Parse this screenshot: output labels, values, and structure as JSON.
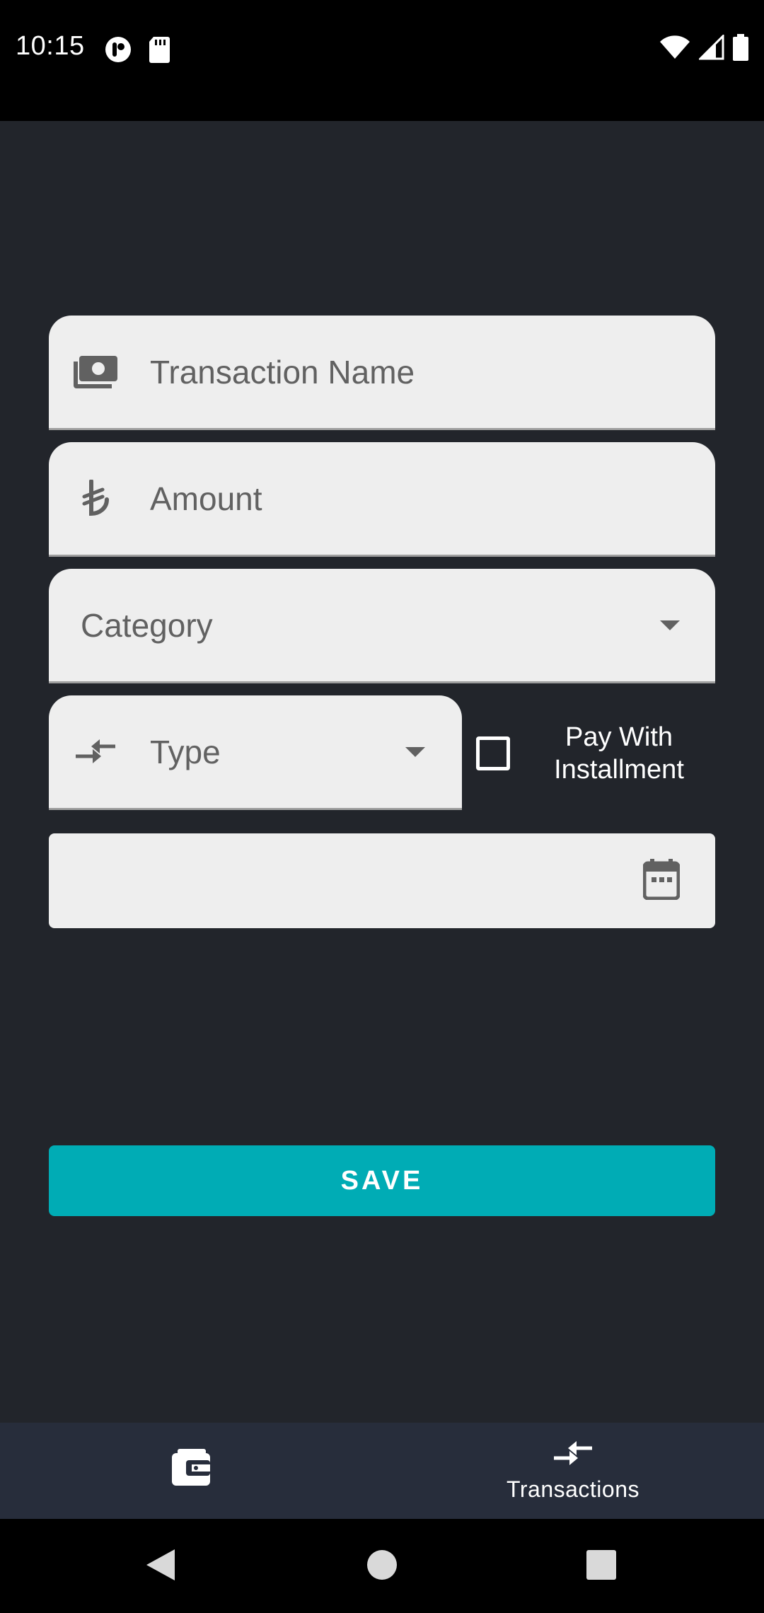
{
  "status_bar": {
    "time": "10:15",
    "icons_left": [
      "app-notification-icon",
      "sd-card-icon"
    ],
    "icons_right": [
      "wifi-icon",
      "cell-signal-icon",
      "battery-icon"
    ]
  },
  "form": {
    "transaction_name": {
      "placeholder": "Transaction Name",
      "icon": "money-icon"
    },
    "amount": {
      "placeholder": "Amount",
      "icon": "lira-currency-icon"
    },
    "category": {
      "placeholder": "Category"
    },
    "type": {
      "placeholder": "Type",
      "icon": "transfer-arrows-icon"
    },
    "installment": {
      "label": "Pay With Installment",
      "checked": false
    },
    "date": {
      "value": "",
      "icon": "calendar-icon"
    },
    "save_label": "SAVE"
  },
  "bottom_nav": {
    "items": [
      {
        "icon": "wallet-icon",
        "label": ""
      },
      {
        "icon": "transfer-arrows-icon",
        "label": "Transactions"
      }
    ]
  },
  "colors": {
    "background": "#22252b",
    "field_bg": "#eeeeee",
    "accent": "#00acb5",
    "nav_bg": "#272d3b"
  }
}
